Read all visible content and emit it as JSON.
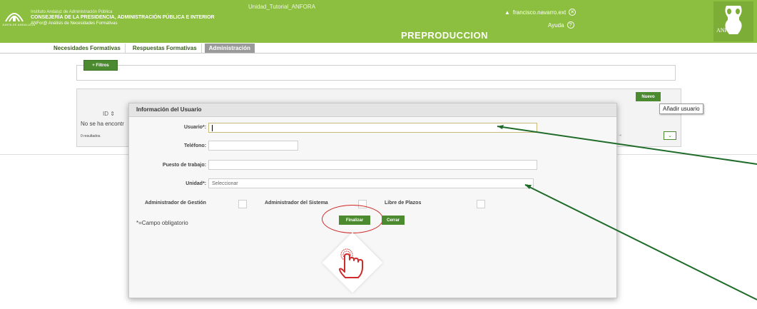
{
  "header": {
    "institute_line1": "Instituto Andaluz de Administración Pública",
    "institute_line2": "CONSEJERÍA DE LA PRESIDENCIA, ADMINISTRACIÓN PÚBLICA E INTERIOR",
    "institute_line3": "ANFor@ Análisis de Necesidades Formativas",
    "junta_label": "JUNTA DE ANDALUCIA",
    "app_title": "Unidad_Tutorial_ANFORA",
    "user_name": "francisco.navarro.ext",
    "help_label": "Ayuda",
    "environment": "PREPRODUCCION",
    "brand": "ANFora",
    "color": "#8cbf3f"
  },
  "tabs": [
    {
      "label": "Necesidades Formativas",
      "active": false
    },
    {
      "label": "Respuestas Formativas",
      "active": false
    },
    {
      "label": "Administración",
      "active": true
    }
  ],
  "filters": {
    "button_label": "+ Filtros"
  },
  "results": {
    "new_button": "Nuevo",
    "tooltip": "Añadir usuario",
    "column_id": "ID ⇕",
    "no_results_text": "No se ha encontr",
    "count_text": "0 resultados.",
    "pager_icons": "⇤ ⇥"
  },
  "modal": {
    "title": "Información del Usuario",
    "usuario_label": "Usuario*:",
    "usuario_value": "",
    "telefono_label": "Teléfono:",
    "telefono_value": "",
    "puesto_label": "Puesto de trabajo:",
    "puesto_value": "",
    "unidad_label": "Unidad*:",
    "unidad_value": "Seleccionar",
    "checkbox_admin_gestion": "Administrador de Gestión",
    "checkbox_admin_sistema": "Administrador del Sistema",
    "checkbox_libre_plazos": "Libre de Plazos",
    "required_note": "*=Campo obligatorio",
    "finalize_button": "Finalizar",
    "close_button": "Cerrar"
  },
  "colors": {
    "accent": "#4b8a2e",
    "highlight": "#d12b2b",
    "arrow": "#1f6b2a"
  }
}
